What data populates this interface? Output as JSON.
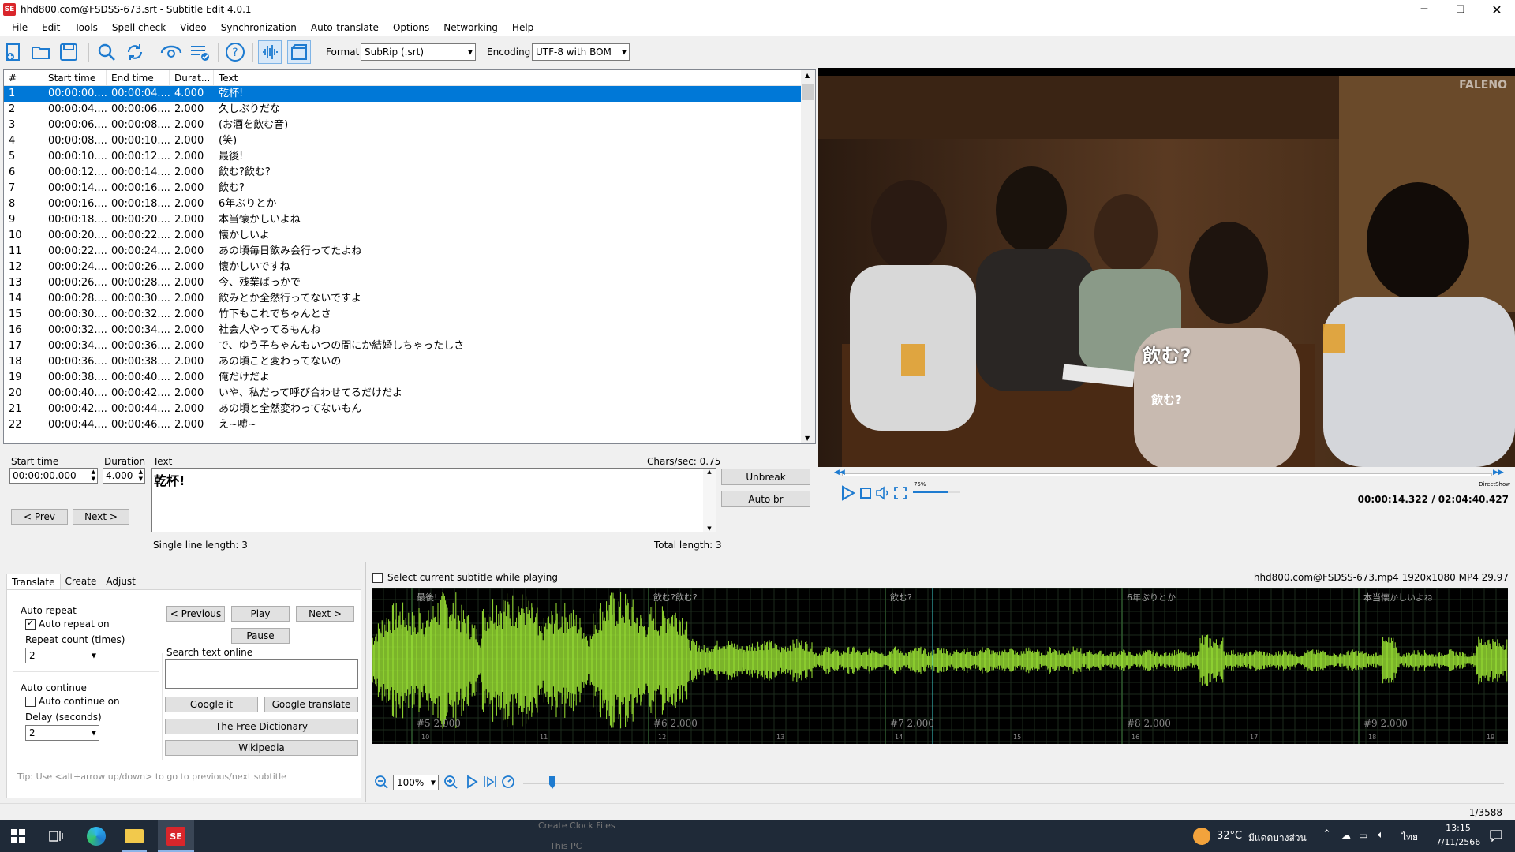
{
  "window": {
    "title": "hhd800.com@FSDSS-673.srt - Subtitle Edit 4.0.1",
    "app_icon": "subtitle-edit-logo"
  },
  "menu": [
    "File",
    "Edit",
    "Tools",
    "Spell check",
    "Video",
    "Synchronization",
    "Auto-translate",
    "Options",
    "Networking",
    "Help"
  ],
  "toolbar": {
    "format_label": "Format",
    "format_value": "SubRip (.srt)",
    "encoding_label": "Encoding",
    "encoding_value": "UTF-8 with BOM"
  },
  "list": {
    "headers": [
      "#",
      "Start time",
      "End time",
      "Durat...",
      "Text"
    ],
    "rows": [
      [
        "1",
        "00:00:00....",
        "00:00:04....",
        "4.000",
        "乾杯!"
      ],
      [
        "2",
        "00:00:04....",
        "00:00:06....",
        "2.000",
        "久しぶりだな"
      ],
      [
        "3",
        "00:00:06....",
        "00:00:08....",
        "2.000",
        "(お酒を飲む音)"
      ],
      [
        "4",
        "00:00:08....",
        "00:00:10....",
        "2.000",
        "(笑)"
      ],
      [
        "5",
        "00:00:10....",
        "00:00:12....",
        "2.000",
        "最後!"
      ],
      [
        "6",
        "00:00:12....",
        "00:00:14....",
        "2.000",
        "飲む?飲む?"
      ],
      [
        "7",
        "00:00:14....",
        "00:00:16....",
        "2.000",
        "飲む?"
      ],
      [
        "8",
        "00:00:16....",
        "00:00:18....",
        "2.000",
        "6年ぶりとか"
      ],
      [
        "9",
        "00:00:18....",
        "00:00:20....",
        "2.000",
        "本当懐かしいよね"
      ],
      [
        "10",
        "00:00:20....",
        "00:00:22....",
        "2.000",
        "懐かしいよ"
      ],
      [
        "11",
        "00:00:22....",
        "00:00:24....",
        "2.000",
        "あの頃毎日飲み会行ってたよね"
      ],
      [
        "12",
        "00:00:24....",
        "00:00:26....",
        "2.000",
        "懐かしいですね"
      ],
      [
        "13",
        "00:00:26....",
        "00:00:28....",
        "2.000",
        "今、残業ばっかで"
      ],
      [
        "14",
        "00:00:28....",
        "00:00:30....",
        "2.000",
        "飲みとか全然行ってないですよ"
      ],
      [
        "15",
        "00:00:30....",
        "00:00:32....",
        "2.000",
        "竹下もこれでちゃんとさ"
      ],
      [
        "16",
        "00:00:32....",
        "00:00:34....",
        "2.000",
        "社会人やってるもんね"
      ],
      [
        "17",
        "00:00:34....",
        "00:00:36....",
        "2.000",
        "で、ゆう子ちゃんもいつの間にか結婚しちゃったしさ"
      ],
      [
        "18",
        "00:00:36....",
        "00:00:38....",
        "2.000",
        "あの頃こと変わってないの"
      ],
      [
        "19",
        "00:00:38....",
        "00:00:40....",
        "2.000",
        "俺だけだよ"
      ],
      [
        "20",
        "00:00:40....",
        "00:00:42....",
        "2.000",
        "いや、私だって呼び合わせてるだけだよ"
      ],
      [
        "21",
        "00:00:42....",
        "00:00:44....",
        "2.000",
        "あの頃と全然変わってないもん"
      ],
      [
        "22",
        "00:00:44....",
        "00:00:46....",
        "2.000",
        "え~嘘~"
      ]
    ]
  },
  "editor": {
    "start_time_label": "Start time",
    "start_time_value": "00:00:00.000",
    "duration_label": "Duration",
    "duration_value": "4.000",
    "text_label": "Text",
    "chars_sec": "Chars/sec: 0.75",
    "text_value": "乾杯!",
    "prev": "< Prev",
    "next": "Next >",
    "unbreak": "Unbreak",
    "auto_br": "Auto br",
    "single_line": "Single line length: 3",
    "total_length": "Total length: 3"
  },
  "video": {
    "subtitle_overlay": "飲む?",
    "subtitle_below": "飲む?",
    "watermark": "FALENO",
    "time": "00:00:14.322 / 02:04:40.427",
    "volume": "75%",
    "volume_level": 0.75,
    "renderer": "DirectShow"
  },
  "tabs": [
    "Translate",
    "Create",
    "Adjust"
  ],
  "translate": {
    "auto_repeat_title": "Auto repeat",
    "auto_repeat_on": "Auto repeat on",
    "repeat_count_label": "Repeat count (times)",
    "repeat_count": "2",
    "auto_continue_title": "Auto continue",
    "auto_continue_on": "Auto continue on",
    "delay_label": "Delay (seconds)",
    "delay": "2",
    "previous": "< Previous",
    "play": "Play",
    "next": "Next >",
    "pause": "Pause",
    "search_label": "Search text online",
    "google_it": "Google it",
    "google_translate": "Google translate",
    "free_dictionary": "The Free Dictionary",
    "wikipedia": "Wikipedia",
    "tip": "Tip: Use <alt+arrow up/down> to go to previous/next subtitle"
  },
  "waveform": {
    "select_current": "Select current subtitle while playing",
    "file_info": "hhd800.com@FSDSS-673.mp4 1920x1080 MP4 29.97",
    "segments": [
      {
        "text": "最後!",
        "label": "#5  2.000"
      },
      {
        "text": "飲む?飲む?",
        "label": "#6  2.000"
      },
      {
        "text": "飲む?",
        "label": "#7  2.000"
      },
      {
        "text": "6年ぶりとか",
        "label": "#8  2.000"
      },
      {
        "text": "本当懐かしいよね",
        "label": "#9  2.000"
      }
    ],
    "ticks": [
      "10",
      "11",
      "12",
      "13",
      "14",
      "15",
      "16",
      "17",
      "18",
      "19"
    ],
    "zoom": "100%",
    "wave_color": "#9ae234"
  },
  "status": {
    "position": "1/3588"
  },
  "taskbar": {
    "temp": "32°C",
    "weather": "มีแดดบางส่วน",
    "lang": "ไทย",
    "time": "13:15",
    "date": "7/11/2566",
    "bg_text1": "Create Clock Files",
    "bg_text2": "This PC"
  }
}
